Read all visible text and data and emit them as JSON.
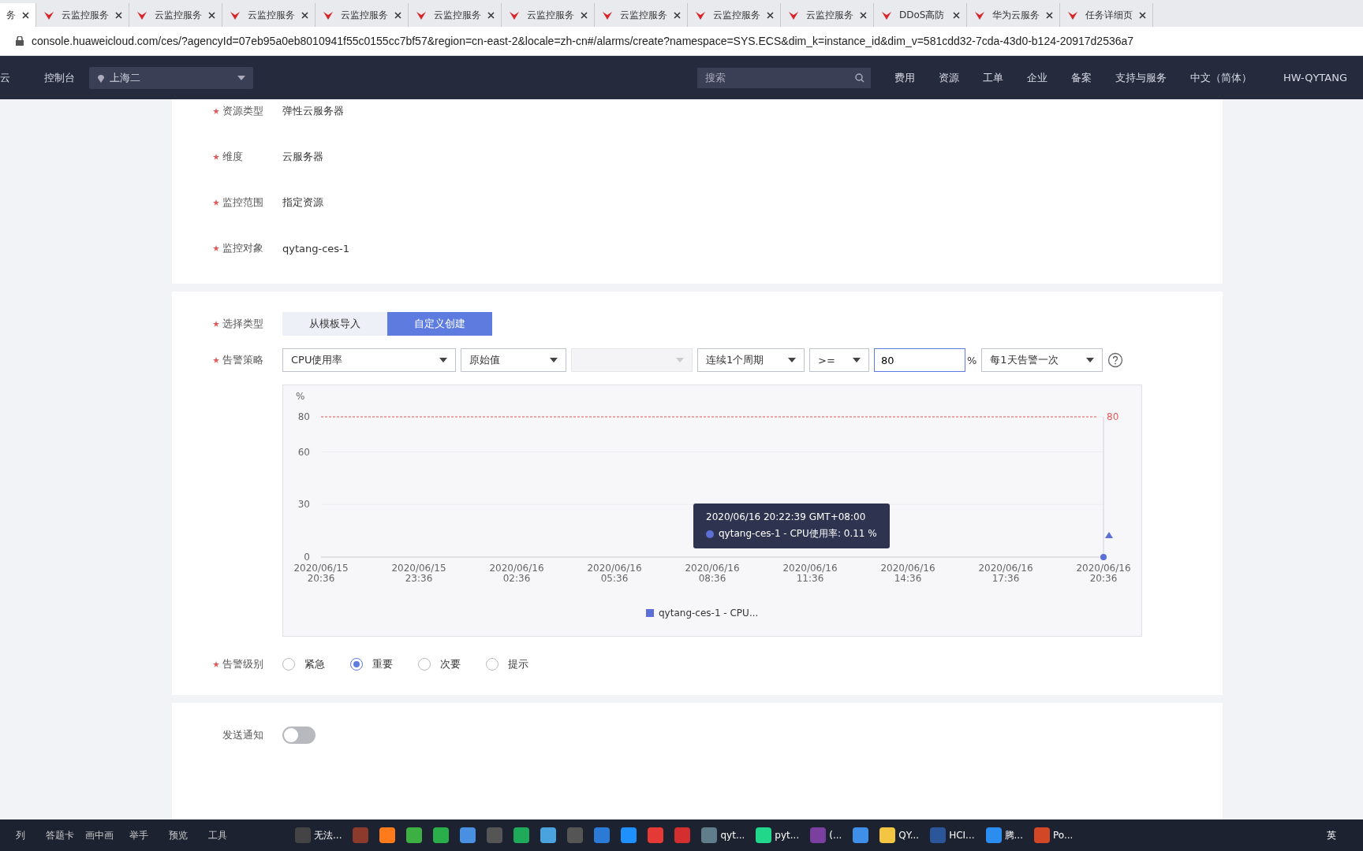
{
  "browser": {
    "tabs": [
      {
        "label": "务",
        "selected": true
      },
      {
        "label": "云监控服务",
        "selected": false
      },
      {
        "label": "云监控服务",
        "selected": false
      },
      {
        "label": "云监控服务",
        "selected": false
      },
      {
        "label": "云监控服务",
        "selected": false
      },
      {
        "label": "云监控服务",
        "selected": false
      },
      {
        "label": "云监控服务",
        "selected": false
      },
      {
        "label": "云监控服务",
        "selected": false
      },
      {
        "label": "云监控服务",
        "selected": false
      },
      {
        "label": "云监控服务",
        "selected": false
      },
      {
        "label": "DDoS高防",
        "selected": false
      },
      {
        "label": "华为云服务",
        "selected": false
      },
      {
        "label": "任务详细页",
        "selected": false
      }
    ],
    "address": "console.huaweicloud.com/ces/?agencyId=07eb95a0eb8010941f55c0155cc7bf57&region=cn-east-2&locale=zh-cn#/alarms/create?namespace=SYS.ECS&dim_k=instance_id&dim_v=581cdd32-7cda-43d0-b124-20917d2536a7"
  },
  "topnav": {
    "brand": "云",
    "console": "控制台",
    "region": "上海二",
    "search": {
      "placeholder": "搜索"
    },
    "links": [
      "费用",
      "资源",
      "工单",
      "企业",
      "备案",
      "支持与服务",
      "中文（简体）"
    ],
    "user": "HW-QYTANG"
  },
  "resource": {
    "fields": [
      {
        "label": "资源类型",
        "value": "弹性云服务器",
        "required": true
      },
      {
        "label": "维度",
        "value": "云服务器",
        "required": true
      },
      {
        "label": "监控范围",
        "value": "指定资源",
        "required": true
      },
      {
        "label": "监控对象",
        "value": "qytang-ces-1",
        "required": true
      }
    ]
  },
  "alarm": {
    "type_label": "选择类型",
    "types": [
      {
        "label": "从模板导入",
        "selected": false
      },
      {
        "label": "自定义创建",
        "selected": true
      }
    ],
    "policy_label": "告警策略",
    "policy": [
      {
        "kind": "select",
        "value": "CPU使用率",
        "disabled": false
      },
      {
        "kind": "select",
        "value": "原始值",
        "disabled": false
      },
      {
        "kind": "select",
        "disabled": true
      },
      {
        "kind": "select",
        "value": "连续1个周期",
        "disabled": false
      },
      {
        "kind": "select",
        "value": ">=",
        "disabled": false
      },
      {
        "kind": "input",
        "value": "80",
        "unit": "%"
      },
      {
        "kind": "select",
        "value": "每1天告警一次",
        "disabled": false
      }
    ],
    "chart_data": {
      "type": "line",
      "ylabel": "%",
      "x": [
        "2020/06/15 20:36",
        "2020/06/15 23:36",
        "2020/06/16 02:36",
        "2020/06/16 05:36",
        "2020/06/16 08:36",
        "2020/06/16 11:36",
        "2020/06/16 14:36",
        "2020/06/16 17:36",
        "2020/06/16 20:36"
      ],
      "yticks": [
        0,
        30,
        60,
        80
      ],
      "ylim": [
        0,
        80
      ],
      "series": [
        {
          "name": "qytang-ces-1 - CPU...",
          "color": "#5b6fd6",
          "marker": "circle",
          "values": [
            null,
            null,
            null,
            null,
            null,
            null,
            null,
            null,
            0
          ]
        }
      ],
      "ref_lines": [
        {
          "label": "80",
          "color": "#e05a5a"
        }
      ]
    },
    "tooltip": {
      "title": "2020/06/16 20:22:39 GMT+08:00",
      "text": "qytang-ces-1 - CPU使用率: 0.11 %"
    },
    "level_label": "告警级别",
    "levels": [
      {
        "label": "紧急",
        "selected": false
      },
      {
        "label": "重要",
        "selected": true
      },
      {
        "label": "次要",
        "selected": false
      },
      {
        "label": "提示",
        "selected": false
      }
    ]
  },
  "notify": {
    "label": "发送通知",
    "on": false
  },
  "taskbar": {
    "tools": [
      "列",
      "答题卡",
      "画中画",
      "举手",
      "预览",
      "工具"
    ],
    "apps": [
      {
        "label": "无法...",
        "color": "#444444"
      },
      {
        "color": "#8b3a2b"
      },
      {
        "color": "#ff7a1a"
      },
      {
        "color": "#3cb043"
      },
      {
        "color": "#2aae4a"
      },
      {
        "color": "#4a90e2"
      },
      {
        "color": "#555555"
      },
      {
        "color": "#1faa59"
      },
      {
        "color": "#4aa3df"
      },
      {
        "color": "#555555"
      },
      {
        "color": "#2b7bd6"
      },
      {
        "color": "#1e90ff"
      },
      {
        "color": "#e53935"
      },
      {
        "color": "#d32f2f"
      },
      {
        "label": "qyt...",
        "color": "#607d8b"
      },
      {
        "label": "pyt...",
        "color": "#21d789"
      },
      {
        "label": "(...",
        "color": "#7b3fa0"
      },
      {
        "color": "#3f8ee8"
      },
      {
        "label": "QY...",
        "color": "#f4c542"
      },
      {
        "label": "HCI...",
        "color": "#2b579a"
      },
      {
        "label": "腾...",
        "color": "#2b8df0"
      },
      {
        "label": "Po...",
        "color": "#d24726"
      }
    ],
    "ime": "英"
  }
}
